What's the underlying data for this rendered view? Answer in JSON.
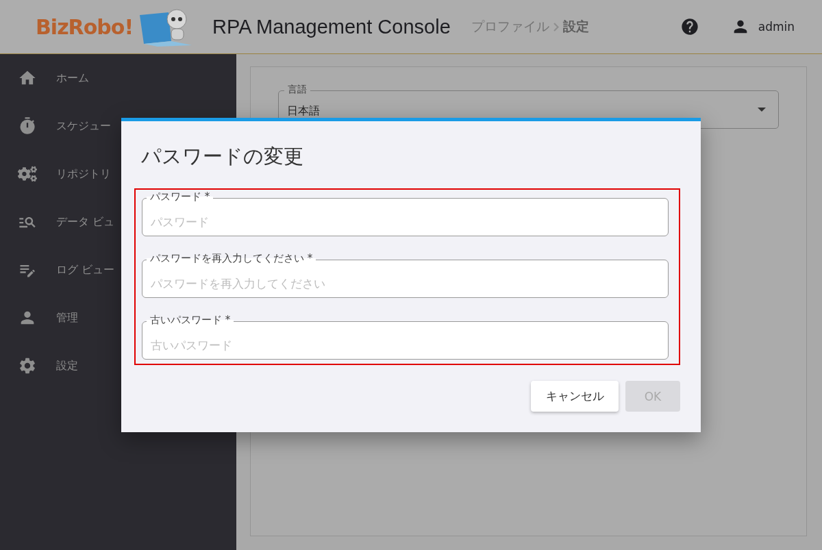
{
  "header": {
    "logo_text": "BizRobo!",
    "title": "RPA Management Console",
    "breadcrumb": [
      "プロファイル",
      "設定"
    ],
    "user": "admin"
  },
  "sidebar": {
    "items": [
      {
        "kind": "home",
        "label": "ホーム"
      },
      {
        "kind": "timer",
        "label": "スケジュー"
      },
      {
        "kind": "gears",
        "label": "リポジトリ"
      },
      {
        "kind": "dataview",
        "label": "データ ビュ"
      },
      {
        "kind": "log",
        "label": "ログ ビュー"
      },
      {
        "kind": "user",
        "label": "管理"
      },
      {
        "kind": "settings",
        "label": "設定"
      }
    ]
  },
  "settings": {
    "language": {
      "label": "言語",
      "value": "日本語"
    }
  },
  "dialog": {
    "title": "パスワードの変更",
    "fields": [
      {
        "label": "パスワード *",
        "placeholder": "パスワード"
      },
      {
        "label": "パスワードを再入力してください *",
        "placeholder": "パスワードを再入力してください"
      },
      {
        "label": "古いパスワード *",
        "placeholder": "古いパスワード"
      }
    ],
    "buttons": [
      {
        "label": "キャンセル",
        "disabled": false
      },
      {
        "label": "OK",
        "disabled": true
      }
    ]
  }
}
